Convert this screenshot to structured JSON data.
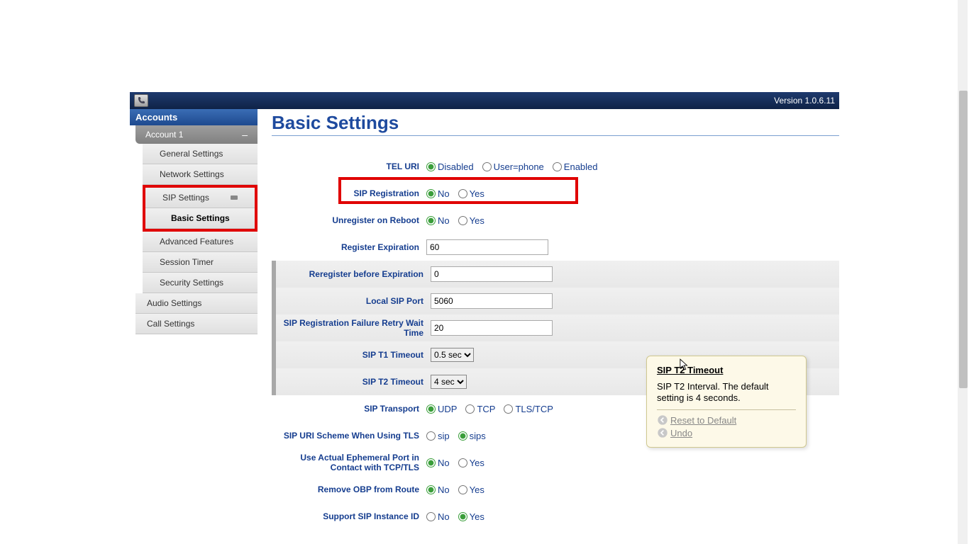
{
  "topbar": {
    "version": "Version 1.0.6.11"
  },
  "sidebar": {
    "title": "Accounts",
    "account": "Account 1",
    "items": {
      "general": "General Settings",
      "network": "Network Settings",
      "sip": "SIP Settings",
      "basic": "Basic Settings",
      "advanced": "Advanced Features",
      "session": "Session Timer",
      "security": "Security Settings",
      "audio": "Audio Settings",
      "call": "Call Settings"
    }
  },
  "page": {
    "title": "Basic Settings"
  },
  "labels": {
    "tel_uri": "TEL URI",
    "sip_reg": "SIP Registration",
    "unreg_reboot": "Unregister on Reboot",
    "reg_exp": "Register Expiration",
    "rereg_before": "Reregister before Expiration",
    "local_sip_port": "Local SIP Port",
    "reg_fail_retry": "SIP Registration Failure Retry Wait Time",
    "t1": "SIP T1 Timeout",
    "t2": "SIP T2 Timeout",
    "transport": "SIP Transport",
    "uri_scheme": "SIP URI Scheme When Using TLS",
    "ephemeral": "Use Actual Ephemeral Port in Contact with TCP/TLS",
    "remove_obp": "Remove OBP from Route",
    "instance_id": "Support SIP Instance ID"
  },
  "opts": {
    "disabled": "Disabled",
    "user_phone": "User=phone",
    "enabled": "Enabled",
    "no": "No",
    "yes": "Yes",
    "udp": "UDP",
    "tcp": "TCP",
    "tlstcp": "TLS/TCP",
    "sip": "sip",
    "sips": "sips",
    "t1_val": "0.5 sec",
    "t2_val": "4 sec"
  },
  "vals": {
    "reg_exp": "60",
    "rereg_before": "0",
    "local_sip_port": "5060",
    "reg_fail_retry": "20"
  },
  "tooltip": {
    "title": "SIP T2 Timeout",
    "body": "SIP T2 Interval. The default setting is 4 seconds.",
    "reset": "Reset to Default",
    "undo": "Undo"
  }
}
